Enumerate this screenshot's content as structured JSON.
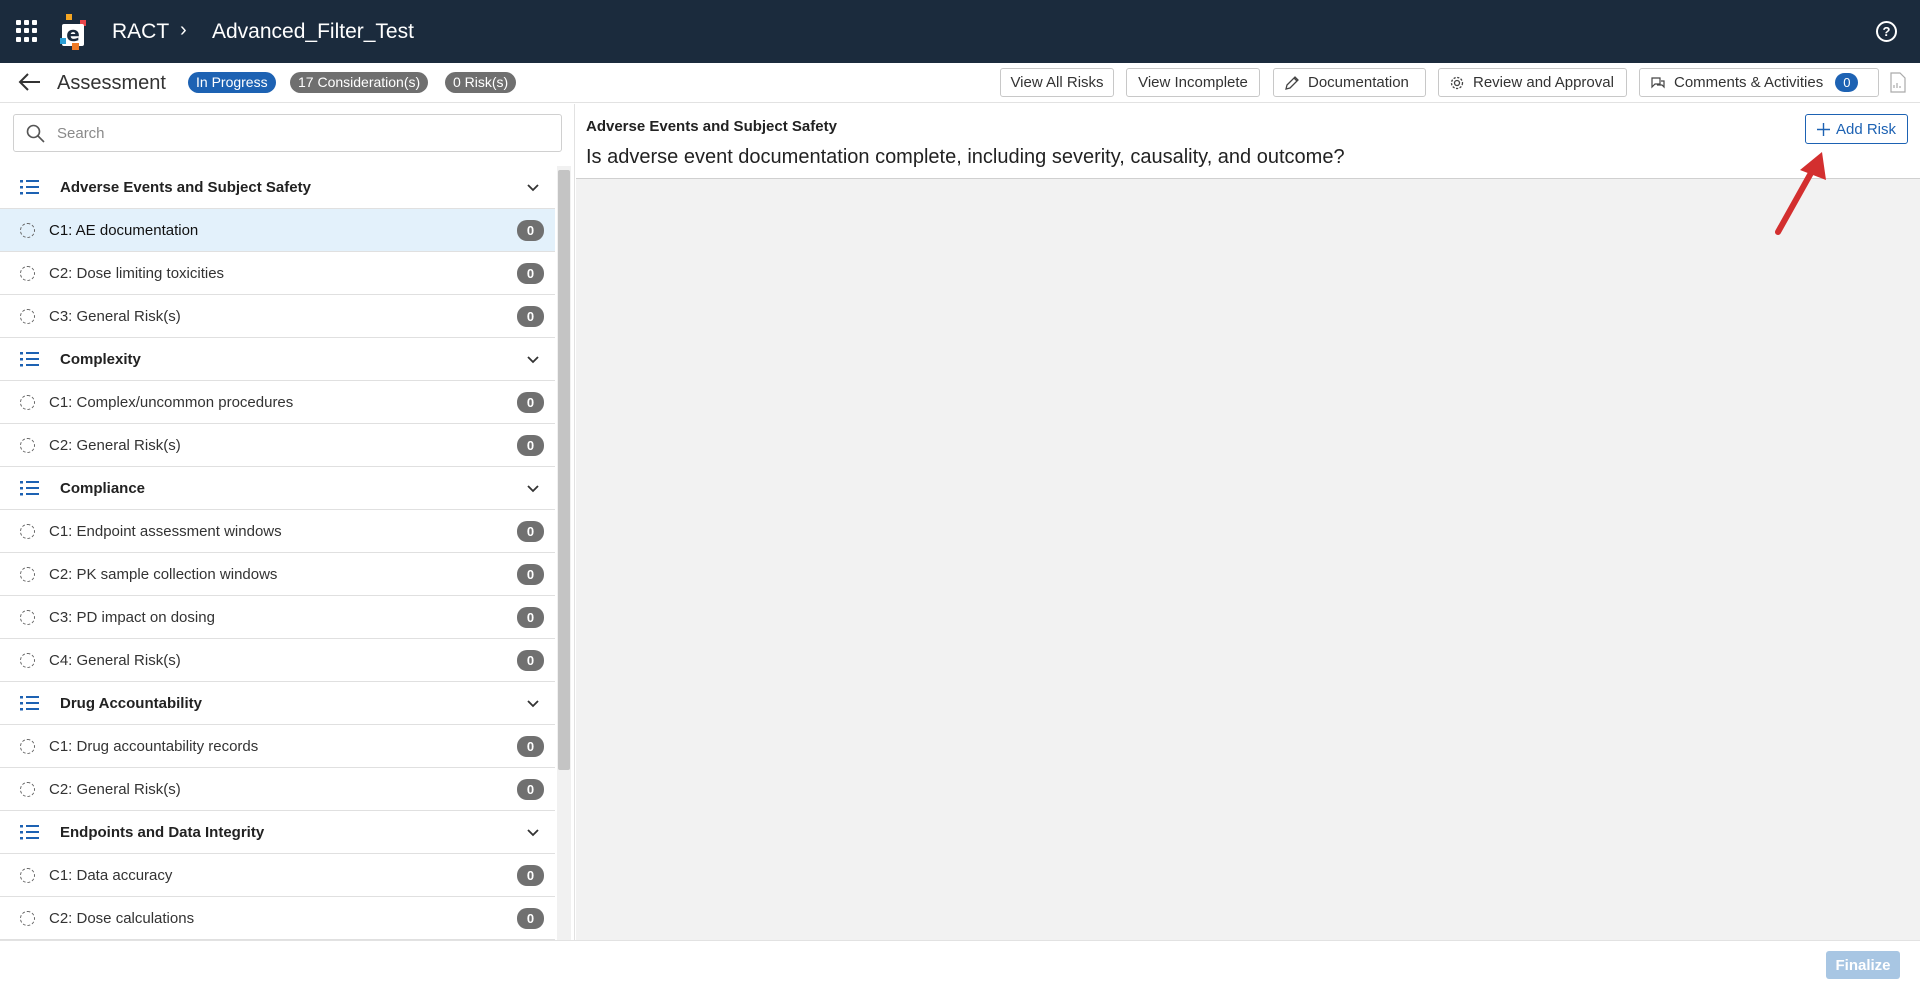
{
  "topbar": {
    "app_name": "RACT",
    "breadcrumb_separator": "›",
    "project_name": "Advanced_Filter_Test",
    "help_label": "?",
    "background": "#1b2b3d"
  },
  "subheader": {
    "title": "Assessment",
    "status_badge": "In Progress",
    "considerations_badge": "17 Consideration(s)",
    "risks_badge": "0 Risk(s)",
    "buttons": {
      "view_all_risks": "View All Risks",
      "view_incomplete": "View Incomplete",
      "documentation": "Documentation",
      "review_and_approval": "Review and Approval",
      "comments_and_activities": "Comments & Activities",
      "comments_count": "0"
    }
  },
  "sidebar": {
    "search_placeholder": "Search",
    "groups": [
      {
        "label": "Adverse Events and Subject Safety",
        "items": [
          {
            "label": "C1: AE documentation",
            "count": "0",
            "selected": true
          },
          {
            "label": "C2: Dose limiting toxicities",
            "count": "0"
          },
          {
            "label": "C3: General Risk(s)",
            "count": "0"
          }
        ]
      },
      {
        "label": "Complexity",
        "items": [
          {
            "label": "C1: Complex/uncommon procedures",
            "count": "0"
          },
          {
            "label": "C2: General Risk(s)",
            "count": "0"
          }
        ]
      },
      {
        "label": "Compliance",
        "items": [
          {
            "label": "C1: Endpoint assessment windows",
            "count": "0"
          },
          {
            "label": "C2: PK sample collection windows",
            "count": "0"
          },
          {
            "label": "C3: PD impact on dosing",
            "count": "0"
          },
          {
            "label": "C4: General Risk(s)",
            "count": "0"
          }
        ]
      },
      {
        "label": "Drug Accountability",
        "items": [
          {
            "label": "C1: Drug accountability records",
            "count": "0"
          },
          {
            "label": "C2: General Risk(s)",
            "count": "0"
          }
        ]
      },
      {
        "label": "Endpoints and Data Integrity",
        "items": [
          {
            "label": "C1: Data accuracy",
            "count": "0"
          },
          {
            "label": "C2: Dose calculations",
            "count": "0"
          }
        ]
      }
    ]
  },
  "main": {
    "section_name": "Adverse Events and Subject Safety",
    "question": "Is adverse event documentation complete, including severity, causality, and outcome?",
    "add_risk_label": "Add Risk"
  },
  "footer": {
    "finalize_label": "Finalize"
  },
  "colors": {
    "accent": "#1d62b3",
    "selected_row": "#e3f1fb",
    "annotation_arrow": "#d32f2f"
  }
}
